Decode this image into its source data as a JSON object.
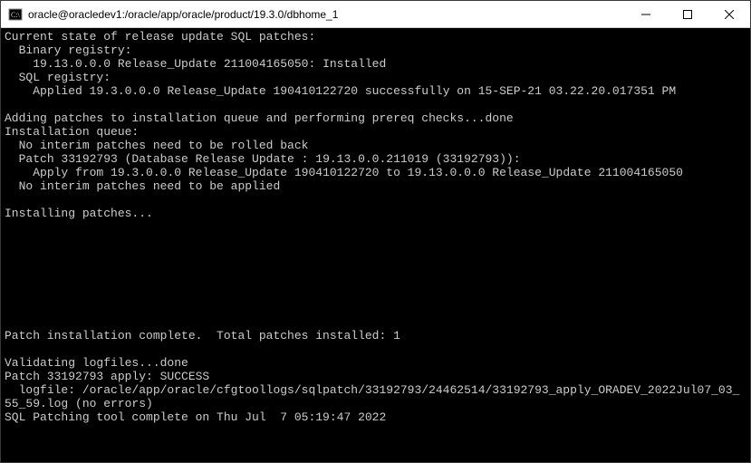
{
  "window": {
    "title": "oracle@oracledev1:/oracle/app/oracle/product/19.3.0/dbhome_1"
  },
  "terminal": {
    "lines": [
      "Current state of release update SQL patches:",
      "  Binary registry:",
      "    19.13.0.0.0 Release_Update 211004165050: Installed",
      "  SQL registry:",
      "    Applied 19.3.0.0.0 Release_Update 190410122720 successfully on 15-SEP-21 03.22.20.017351 PM",
      "",
      "Adding patches to installation queue and performing prereq checks...done",
      "Installation queue:",
      "  No interim patches need to be rolled back",
      "  Patch 33192793 (Database Release Update : 19.13.0.0.211019 (33192793)):",
      "    Apply from 19.3.0.0.0 Release_Update 190410122720 to 19.13.0.0.0 Release_Update 211004165050",
      "  No interim patches need to be applied",
      "",
      "Installing patches...",
      "",
      "",
      "",
      "",
      "",
      "",
      "",
      "",
      "Patch installation complete.  Total patches installed: 1",
      "",
      "Validating logfiles...done",
      "Patch 33192793 apply: SUCCESS",
      "  logfile: /oracle/app/oracle/cfgtoollogs/sqlpatch/33192793/24462514/33192793_apply_ORADEV_2022Jul07_03_55_59.log (no errors)",
      "SQL Patching tool complete on Thu Jul  7 05:19:47 2022",
      ""
    ]
  }
}
